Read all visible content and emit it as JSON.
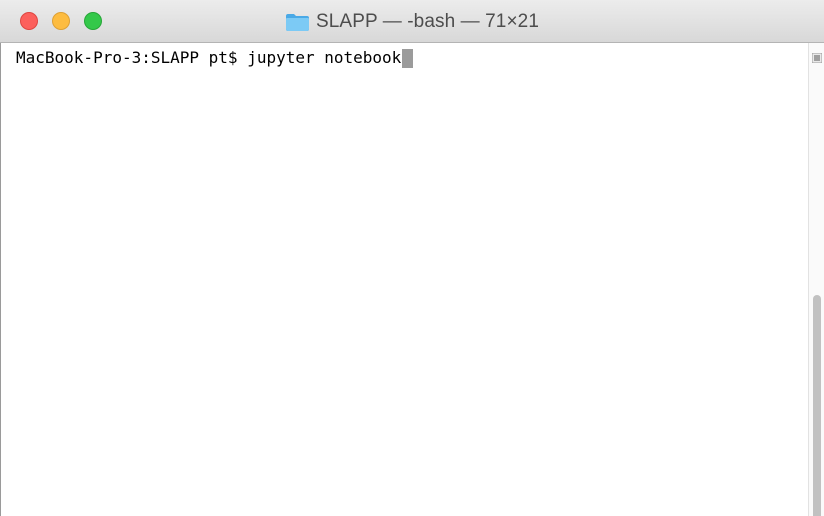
{
  "window": {
    "title": "SLAPP — -bash — 71×21",
    "title_icon": "folder-icon",
    "controls": [
      "close",
      "minimize",
      "zoom"
    ]
  },
  "terminal": {
    "prompt": "MacBook-Pro-3:SLAPP pt$ ",
    "command": "jupyter notebook",
    "cursor": "block"
  },
  "colors": {
    "close": "#fc605c",
    "minimize": "#fdbc40",
    "zoom": "#34c84a",
    "folder": "#5ab8f0",
    "cursor": "#9b9b9b",
    "background": "#ffffff"
  }
}
